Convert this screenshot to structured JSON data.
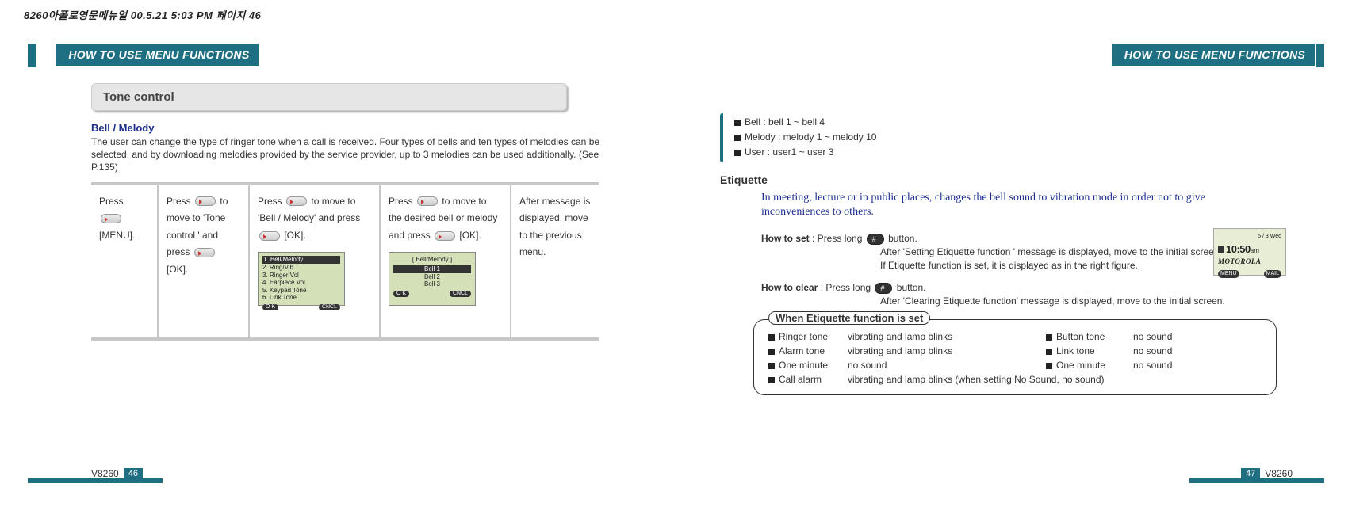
{
  "header_line": "8260아폴로영문메뉴얼   00.5.21 5:03 PM  페이지 46",
  "tab_left": "HOW TO USE MENU FUNCTIONS",
  "tab_right": "HOW TO USE MENU FUNCTIONS",
  "tone_banner": "Tone control",
  "bell_melody_title": "Bell / Melody",
  "bell_melody_body": "The user can change  the type of  ringer tone when  a call is received.  Four types of bells and ten types of melodies can  be selected, and by downloading melodies provided by the service provider, up to 3 melodies can be used additionally. (See P.135)",
  "steps": {
    "s1a": "Press",
    "s1b": "[MENU].",
    "s2a": "Press",
    "s2b": "to move to  'Tone control '  and press",
    "s2c": "[OK].",
    "s3a": "Press",
    "s3b": "to move to 'Bell / Melody'  and press",
    "s3c": "[OK].",
    "s4a": "Press",
    "s4b": "to move to the desired bell or melody and press",
    "s4c": "[OK].",
    "s5": "After message is displayed, move to the previous menu."
  },
  "screen1": {
    "l1": "1. Bell/Melody",
    "l2": "2. Ring/Vib",
    "l3": "3. Ringer Vol",
    "l4": "4. Earpiece Vol",
    "l5": "5. Keypad Tone",
    "l6": "6. Link Tone",
    "ok": "O K",
    "cncl": "CNCL"
  },
  "screen2": {
    "title": "[ Bell/Melody ]",
    "l1": "Bell 1",
    "l2": "Bell 2",
    "l3": "Bell 3",
    "ok": "O K",
    "cncl": "CNCL"
  },
  "footer_left_model": "V8260",
  "footer_left_page": "46",
  "footer_right_page": "47",
  "footer_right_model": "V8260",
  "right_list": {
    "i1": "Bell : bell 1 ~ bell 4",
    "i2": "Melody : melody 1 ~ melody 10",
    "i3": "User : user1 ~ user 3"
  },
  "etiquette_title": "Etiquette",
  "etiquette_desc": "In meeting, lecture  or in public  places, changes  the bell sound  to vibration  mode in order not to give inconveniences to others.",
  "how_to_set_label": "How to set",
  "how_to_set_1": ":  Press long",
  "how_to_set_1b": "button.",
  "how_to_set_2": "After  'Setting Etiquette function '   message is displayed, move to the initial screen.",
  "how_to_set_3": "If Etiquette function is set, it is displayed as in the right figure.",
  "how_to_clear_label": "How to clear",
  "how_to_clear_1": ": Press long",
  "how_to_clear_1b": "button.",
  "how_to_clear_2": "After  'Clearing Etiquette function'  message is  displayed, move to the initial screen.",
  "mini": {
    "date": "5 / 3  Wed",
    "time": "10:50",
    "ampm": "am",
    "brand": "MOTOROLA",
    "menu": "MENU",
    "mail": "MAIL"
  },
  "when_legend": "When Etiquette function is set",
  "when_rows": {
    "r1c1": "Ringer tone",
    "r1c2": "vibrating and lamp blinks",
    "r1c3": "Button tone",
    "r1c4": "no sound",
    "r2c1": "Alarm tone",
    "r2c2": "vibrating and lamp blinks",
    "r2c3": "Link tone",
    "r2c4": "no sound",
    "r3c1": "One minute",
    "r3c2": "no sound",
    "r3c3": "One minute",
    "r3c4": "no sound",
    "r4c1": "Call alarm",
    "r4c2": "vibrating and lamp blinks (when setting No Sound, no sound)"
  }
}
